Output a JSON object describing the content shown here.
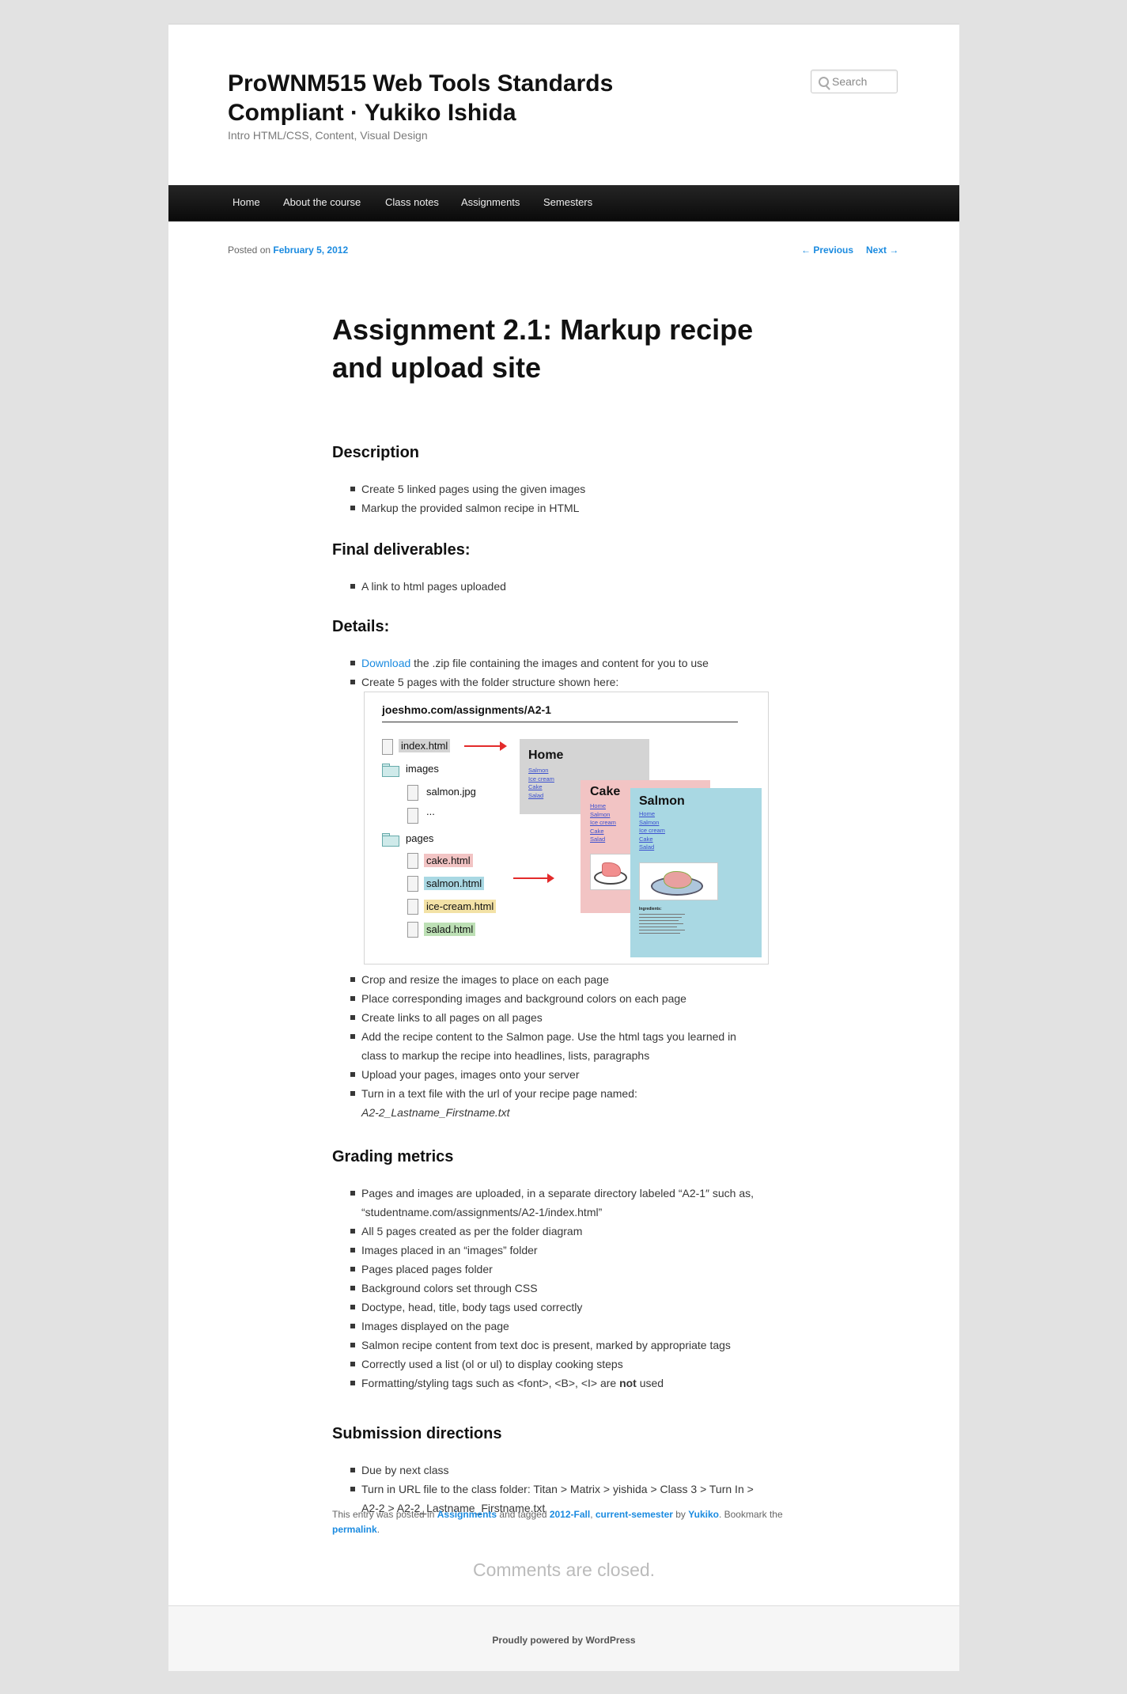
{
  "site": {
    "title": "ProWNM515 Web Tools Standards Compliant · Yukiko Ishida",
    "description": "Intro HTML/CSS, Content, Visual Design",
    "search_placeholder": "Search"
  },
  "nav": [
    "Home",
    "About the course",
    "Class notes",
    "Assignments",
    "Semesters"
  ],
  "post_meta": {
    "posted_on": "Posted on",
    "date": "February 5, 2012",
    "previous": "← Previous",
    "next": "Next →"
  },
  "article": {
    "title": "Assignment 2.1: Markup recipe and upload site",
    "description_heading": "Description",
    "description_items": [
      "Create 5 linked pages using the given images",
      "Markup the provided salmon recipe in HTML"
    ],
    "deliverables_heading": "Final deliverables:",
    "deliverables_items": [
      "A link to html pages uploaded"
    ],
    "details_heading": "Details:",
    "details_download_link": "Download",
    "details_download_rest": " the .zip file containing the images and content for you to use",
    "details_item2": "Create 5 pages with the folder structure shown here:",
    "details_items_after": [
      "Crop and resize the images to place on each page",
      "Place corresponding images and background colors on each page",
      "Create links to all pages on all pages",
      "Add the recipe content to the Salmon page. Use the html tags you learned in class to markup the recipe into headlines, lists, paragraphs",
      "Upload your pages, images onto your server"
    ],
    "details_turnin": "Turn in a text file with the url of your recipe page named:",
    "details_turnin_file": "A2-2_Lastname_Firstname.txt",
    "grading_heading": "Grading metrics",
    "grading_items": [
      "Pages and images are uploaded, in a separate directory labeled “A2-1″ such as, “studentname.com/assignments/A2-1/index.html”",
      "All 5 pages created as per the folder diagram",
      "Images placed in an “images” folder",
      "Pages placed pages folder",
      "Background colors set through CSS",
      "Doctype, head, title, body tags used correctly",
      "Images displayed on the page",
      "Salmon recipe content from text doc is present, marked by appropriate tags",
      "Correctly used a list (ol or ul) to display cooking steps"
    ],
    "grading_last_pre": "Formatting/styling tags such as <font>, <B>, <I> are ",
    "grading_last_bold": "not",
    "grading_last_post": " used",
    "submission_heading": "Submission directions",
    "submission_items": [
      "Due by next class",
      "Turn in URL file to the class folder: Titan > Matrix > yishida > Class 3 > Turn In > A2-2 > A2-2_Lastname_Firstname.txt"
    ]
  },
  "diagram": {
    "url": "joeshmo.com/assignments/A2-1",
    "files": {
      "index": "index.html",
      "images": "images",
      "salmon_jpg": "salmon.jpg",
      "ellipsis": "...",
      "pages": "pages",
      "cake": "cake.html",
      "salmon": "salmon.html",
      "icecream": "ice-cream.html",
      "salad": "salad.html"
    },
    "cards": {
      "home": "Home",
      "cake": "Cake",
      "salmon": "Salmon",
      "links": [
        "Home",
        "Salmon",
        "Ice cream",
        "Cake",
        "Salad"
      ],
      "ingredients": "Ingredients:"
    },
    "colors": {
      "index": "#d4d4d4",
      "cake": "#f2c4c4",
      "salmon": "#a9d8e3",
      "icecream": "#f3e2a6",
      "salad": "#bde0b5",
      "arrow": "#e32b2b"
    }
  },
  "entry_footer": {
    "pre": "This entry was posted in ",
    "category": "Assignments",
    "tagged": " and tagged ",
    "tag1": "2012-Fall",
    "comma": ", ",
    "tag2": "current-semester",
    "by": " by ",
    "author": "Yukiko",
    "bookmark": ". Bookmark the ",
    "permalink": "permalink",
    "end": "."
  },
  "comments_closed": "Comments are closed.",
  "footer": {
    "powered": "Proudly powered by WordPress"
  }
}
